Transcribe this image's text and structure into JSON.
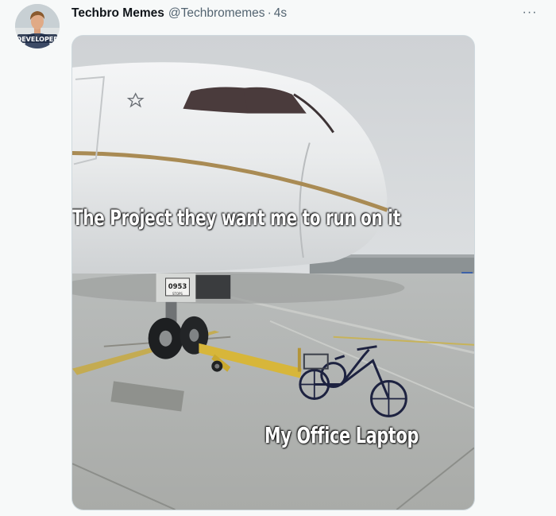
{
  "tweet": {
    "display_name": "Techbro Memes",
    "handle": "@Techbromemes",
    "separator": "·",
    "time": "4s",
    "more_label": "···"
  },
  "avatar": {
    "badge_text": "DEVELOPER"
  },
  "meme": {
    "caption_top": "The Project they want me to run on it",
    "caption_bottom": "My Office Laptop",
    "gear_number": "0953",
    "gear_stops": "STOPS"
  }
}
